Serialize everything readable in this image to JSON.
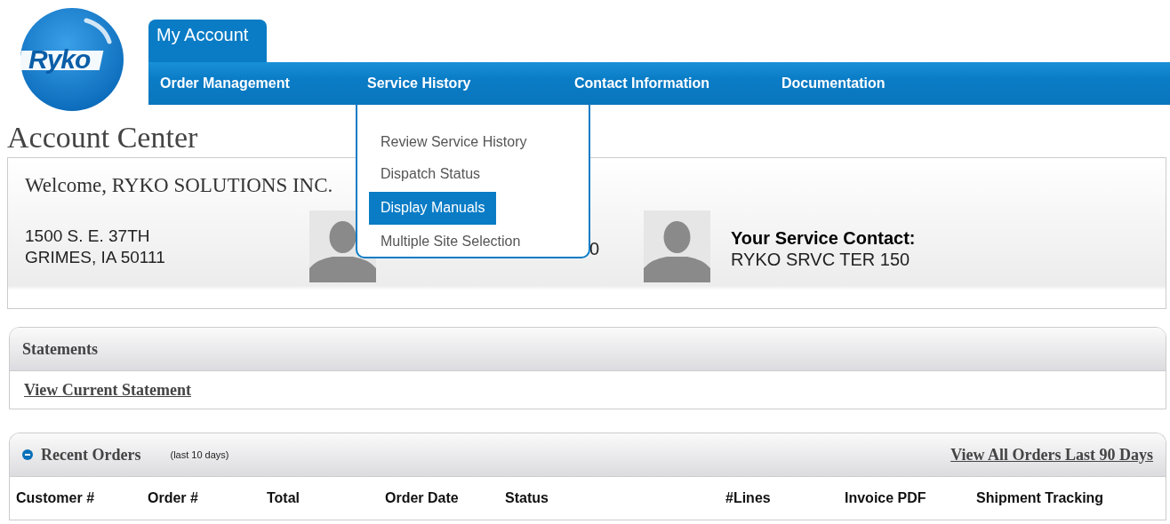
{
  "logo": {
    "text": "Ryko"
  },
  "tabs": [
    {
      "label": "My Account",
      "selected": true
    }
  ],
  "nav": [
    {
      "label": "Order Management"
    },
    {
      "label": "Service History",
      "menu": [
        {
          "label": "Review Service History",
          "selected": false
        },
        {
          "label": "Dispatch Status",
          "selected": false
        },
        {
          "label": "Display Manuals",
          "selected": true
        },
        {
          "label": "Multiple Site Selection",
          "selected": false
        }
      ]
    },
    {
      "label": "Contact Information"
    },
    {
      "label": "Documentation"
    }
  ],
  "page_title": "Account Center",
  "welcome": {
    "greeting": "Welcome, RYKO SOLUTIONS INC.",
    "address": [
      "1500 S. E. 37TH",
      "GRIMES, IA 50111"
    ],
    "contacts": [
      {
        "lines": [
          "0"
        ]
      },
      {
        "heading": "Your Service Contact:",
        "lines": [
          "RYKO SRVC TER 150"
        ]
      }
    ]
  },
  "statements": {
    "title": "Statements",
    "link": "View Current Statement"
  },
  "recent_orders": {
    "title": "Recent Orders",
    "note": "(last 10 days)",
    "expanded": true,
    "link": "View All Orders Last 90 Days",
    "columns": [
      "Customer #",
      "Order #",
      "Total",
      "Order Date",
      "Status",
      "#Lines",
      "Invoice PDF",
      "Shipment Tracking"
    ]
  }
}
